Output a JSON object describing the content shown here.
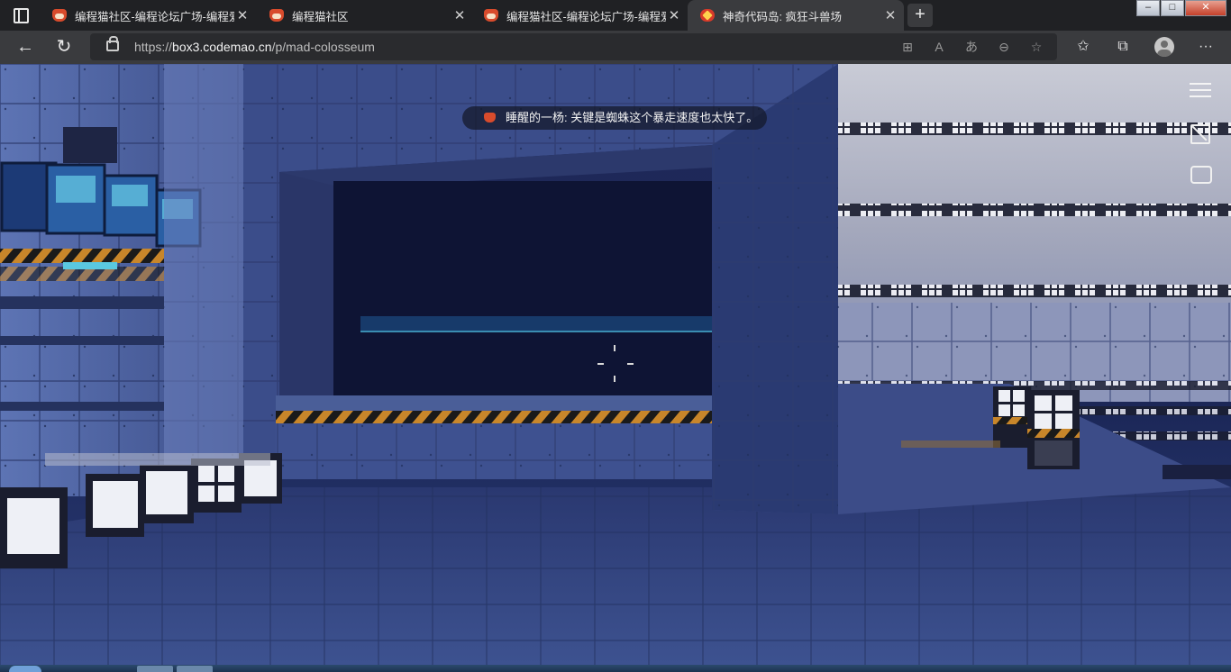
{
  "tabs": [
    {
      "title": "编程猫社区-编程论坛广场-编程爱",
      "active": false,
      "favicon": "codemao-cat-icon"
    },
    {
      "title": "编程猫社区",
      "active": false,
      "favicon": "codemao-cat-icon"
    },
    {
      "title": "编程猫社区-编程论坛广场-编程爱",
      "active": false,
      "favicon": "codemao-cat-icon"
    },
    {
      "title": "神奇代码岛: 疯狂斗兽场",
      "active": true,
      "favicon": "codemao-island-icon"
    }
  ],
  "window_controls": {
    "minimize": "–",
    "maximize": "□",
    "close": "✕"
  },
  "address_bar": {
    "scheme": "https://",
    "domain": "box3.codemao.cn",
    "path": "/p/mad-colosseum"
  },
  "game": {
    "chat_message": "睡醒的一杨: 关键是蜘蛛这个暴走速度也太快了。"
  },
  "colors": {
    "chrome_dark": "#202124",
    "toolbar": "#3a3b3e",
    "wall_blue": "#4a5e98",
    "hazard_orange": "#c8862a"
  }
}
